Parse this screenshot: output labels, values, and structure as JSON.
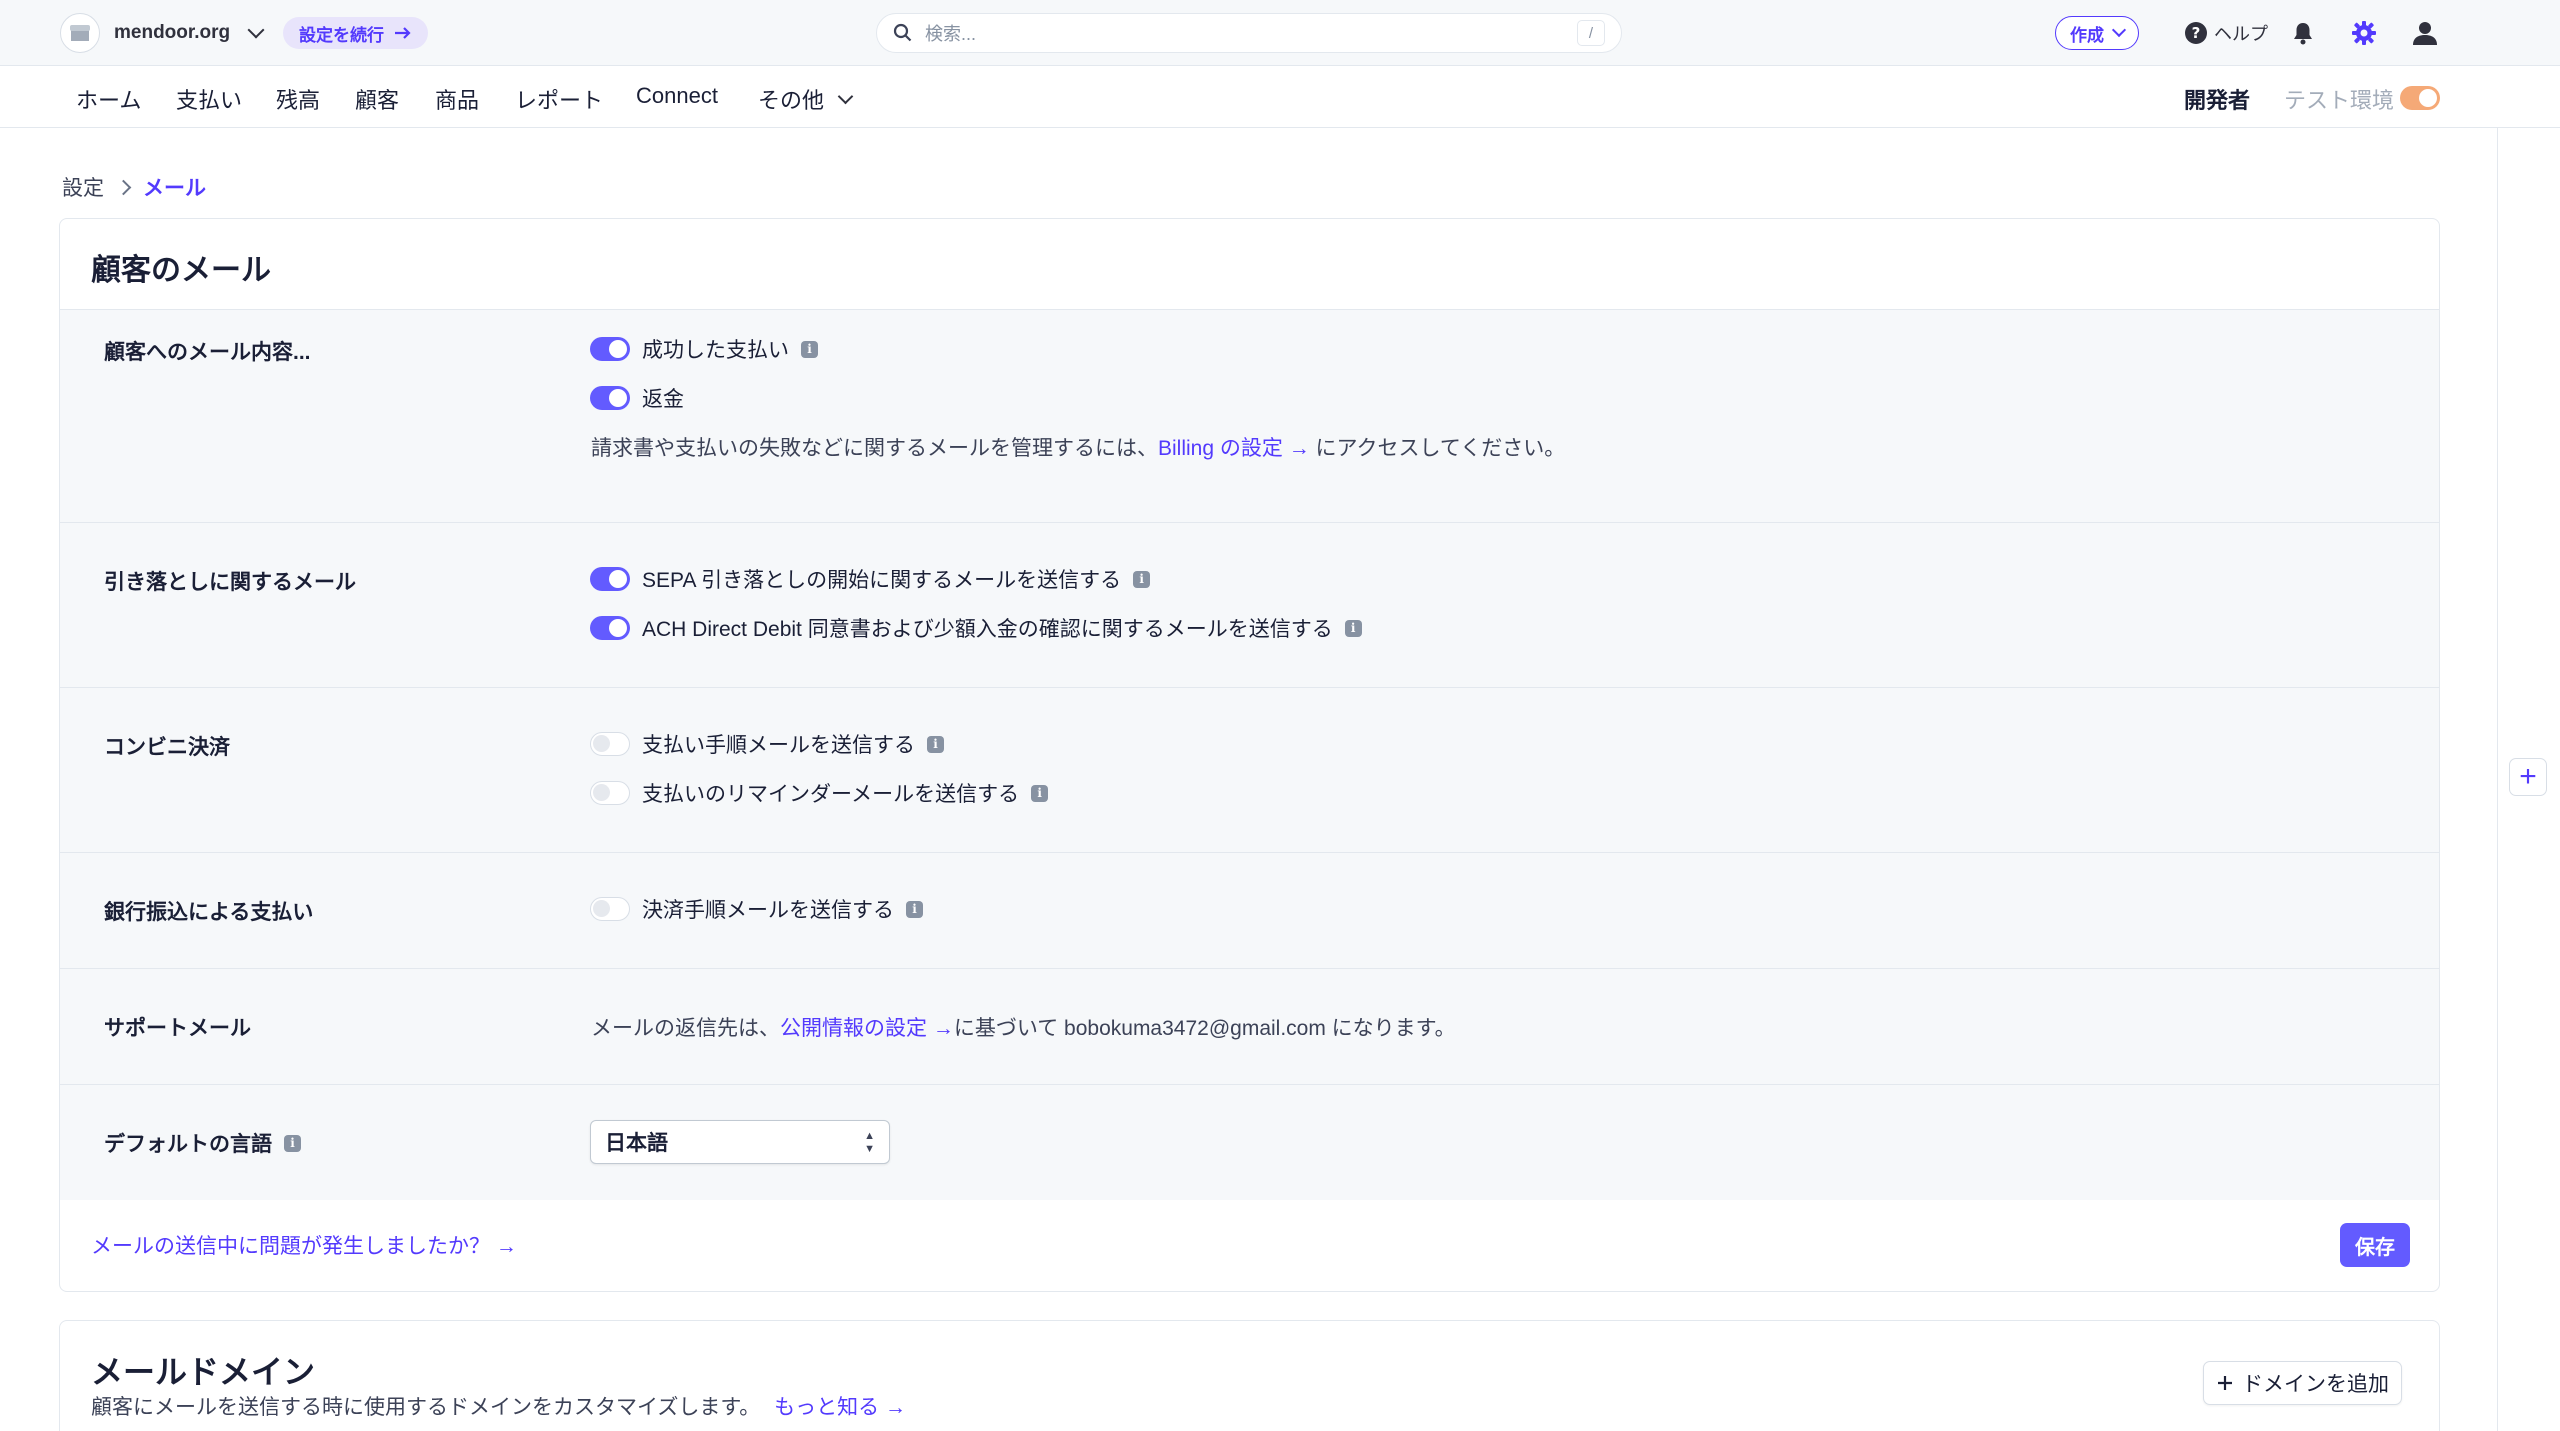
{
  "topbar": {
    "account_name": "mendoor.org",
    "continue_label": "設定を続行",
    "search_placeholder": "検索...",
    "search_shortcut": "/",
    "create_label": "作成",
    "help_label": "ヘルプ"
  },
  "nav": {
    "items": [
      "ホーム",
      "支払い",
      "残高",
      "顧客",
      "商品",
      "レポート",
      "Connect",
      "その他"
    ],
    "developers_label": "開発者",
    "test_mode_label": "テスト環境",
    "test_mode_on": true
  },
  "breadcrumb": {
    "parent": "設定",
    "current": "メール"
  },
  "customer_emails": {
    "title": "顧客のメール",
    "sections": [
      {
        "label": "顧客へのメール内容...",
        "options": [
          {
            "label": "成功した支払い",
            "on": true,
            "info": true
          },
          {
            "label": "返金",
            "on": true,
            "info": false
          }
        ],
        "note_before": "請求書や支払いの失敗などに関するメールを管理するには、",
        "note_link": "Billing の設定 →",
        "note_after": " にアクセスしてください。"
      },
      {
        "label": "引き落としに関するメール",
        "options": [
          {
            "label": "SEPA 引き落としの開始に関するメールを送信する",
            "on": true,
            "info": true
          },
          {
            "label": "ACH Direct Debit 同意書および少額入金の確認に関するメールを送信する",
            "on": true,
            "info": true
          }
        ]
      },
      {
        "label": "コンビニ決済",
        "options": [
          {
            "label": "支払い手順メールを送信する",
            "on": false,
            "info": true
          },
          {
            "label": "支払いのリマインダーメールを送信する",
            "on": false,
            "info": true
          }
        ]
      },
      {
        "label": "銀行振込による支払い",
        "options": [
          {
            "label": "決済手順メールを送信する",
            "on": false,
            "info": true
          }
        ]
      },
      {
        "label": "サポートメール",
        "text_before": "メールの返信先は、",
        "text_link": "公開情報の設定 →",
        "text_after": "に基づいて bobokuma3472@gmail.com になります。"
      },
      {
        "label": "デフォルトの言語",
        "select_value": "日本語"
      }
    ],
    "footer_link": "メールの送信中に問題が発生しましたか？ →",
    "save_label": "保存"
  },
  "email_domain": {
    "title": "メールドメイン",
    "description": "顧客にメールを送信する時に使用するドメインをカスタマイズします。",
    "learn_more": "もっと知る →",
    "add_domain_label": "ドメインを追加"
  },
  "colors": {
    "accent": "#635bff",
    "link": "#533afd",
    "test_mode": "#f5a977"
  },
  "icons": [
    "store-icon",
    "chevron-down-icon",
    "arrow-right-icon",
    "search-icon",
    "help-icon",
    "bell-icon",
    "gear-icon",
    "user-icon",
    "info-icon",
    "plus-icon",
    "up-down-icon"
  ]
}
